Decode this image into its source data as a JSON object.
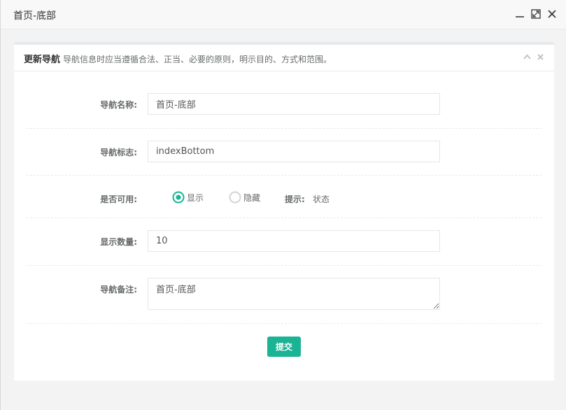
{
  "window": {
    "title": "首页-底部"
  },
  "panel": {
    "heading": "更新导航",
    "description": "导航信息时应当遵循合法、正当、必要的原则，明示目的、方式和范围。"
  },
  "form": {
    "name_label": "导航名称:",
    "name_value": "首页-底部",
    "flag_label": "导航标志:",
    "flag_value": "indexBottom",
    "enabled_label": "是否可用:",
    "enabled_options": [
      "显示",
      "隐藏"
    ],
    "enabled_selected": "显示",
    "hint_label": "提示:",
    "hint_value": "状态",
    "count_label": "显示数量:",
    "count_value": "10",
    "remark_label": "导航备注:",
    "remark_value": "首页-底部",
    "submit_label": "提交"
  },
  "colors": {
    "accent": "#1ab394"
  },
  "icons": {
    "minimize": "minimize-icon",
    "maximize": "maximize-icon",
    "close": "close-icon",
    "collapse": "chevron-up-icon",
    "panel_close": "close-icon"
  }
}
